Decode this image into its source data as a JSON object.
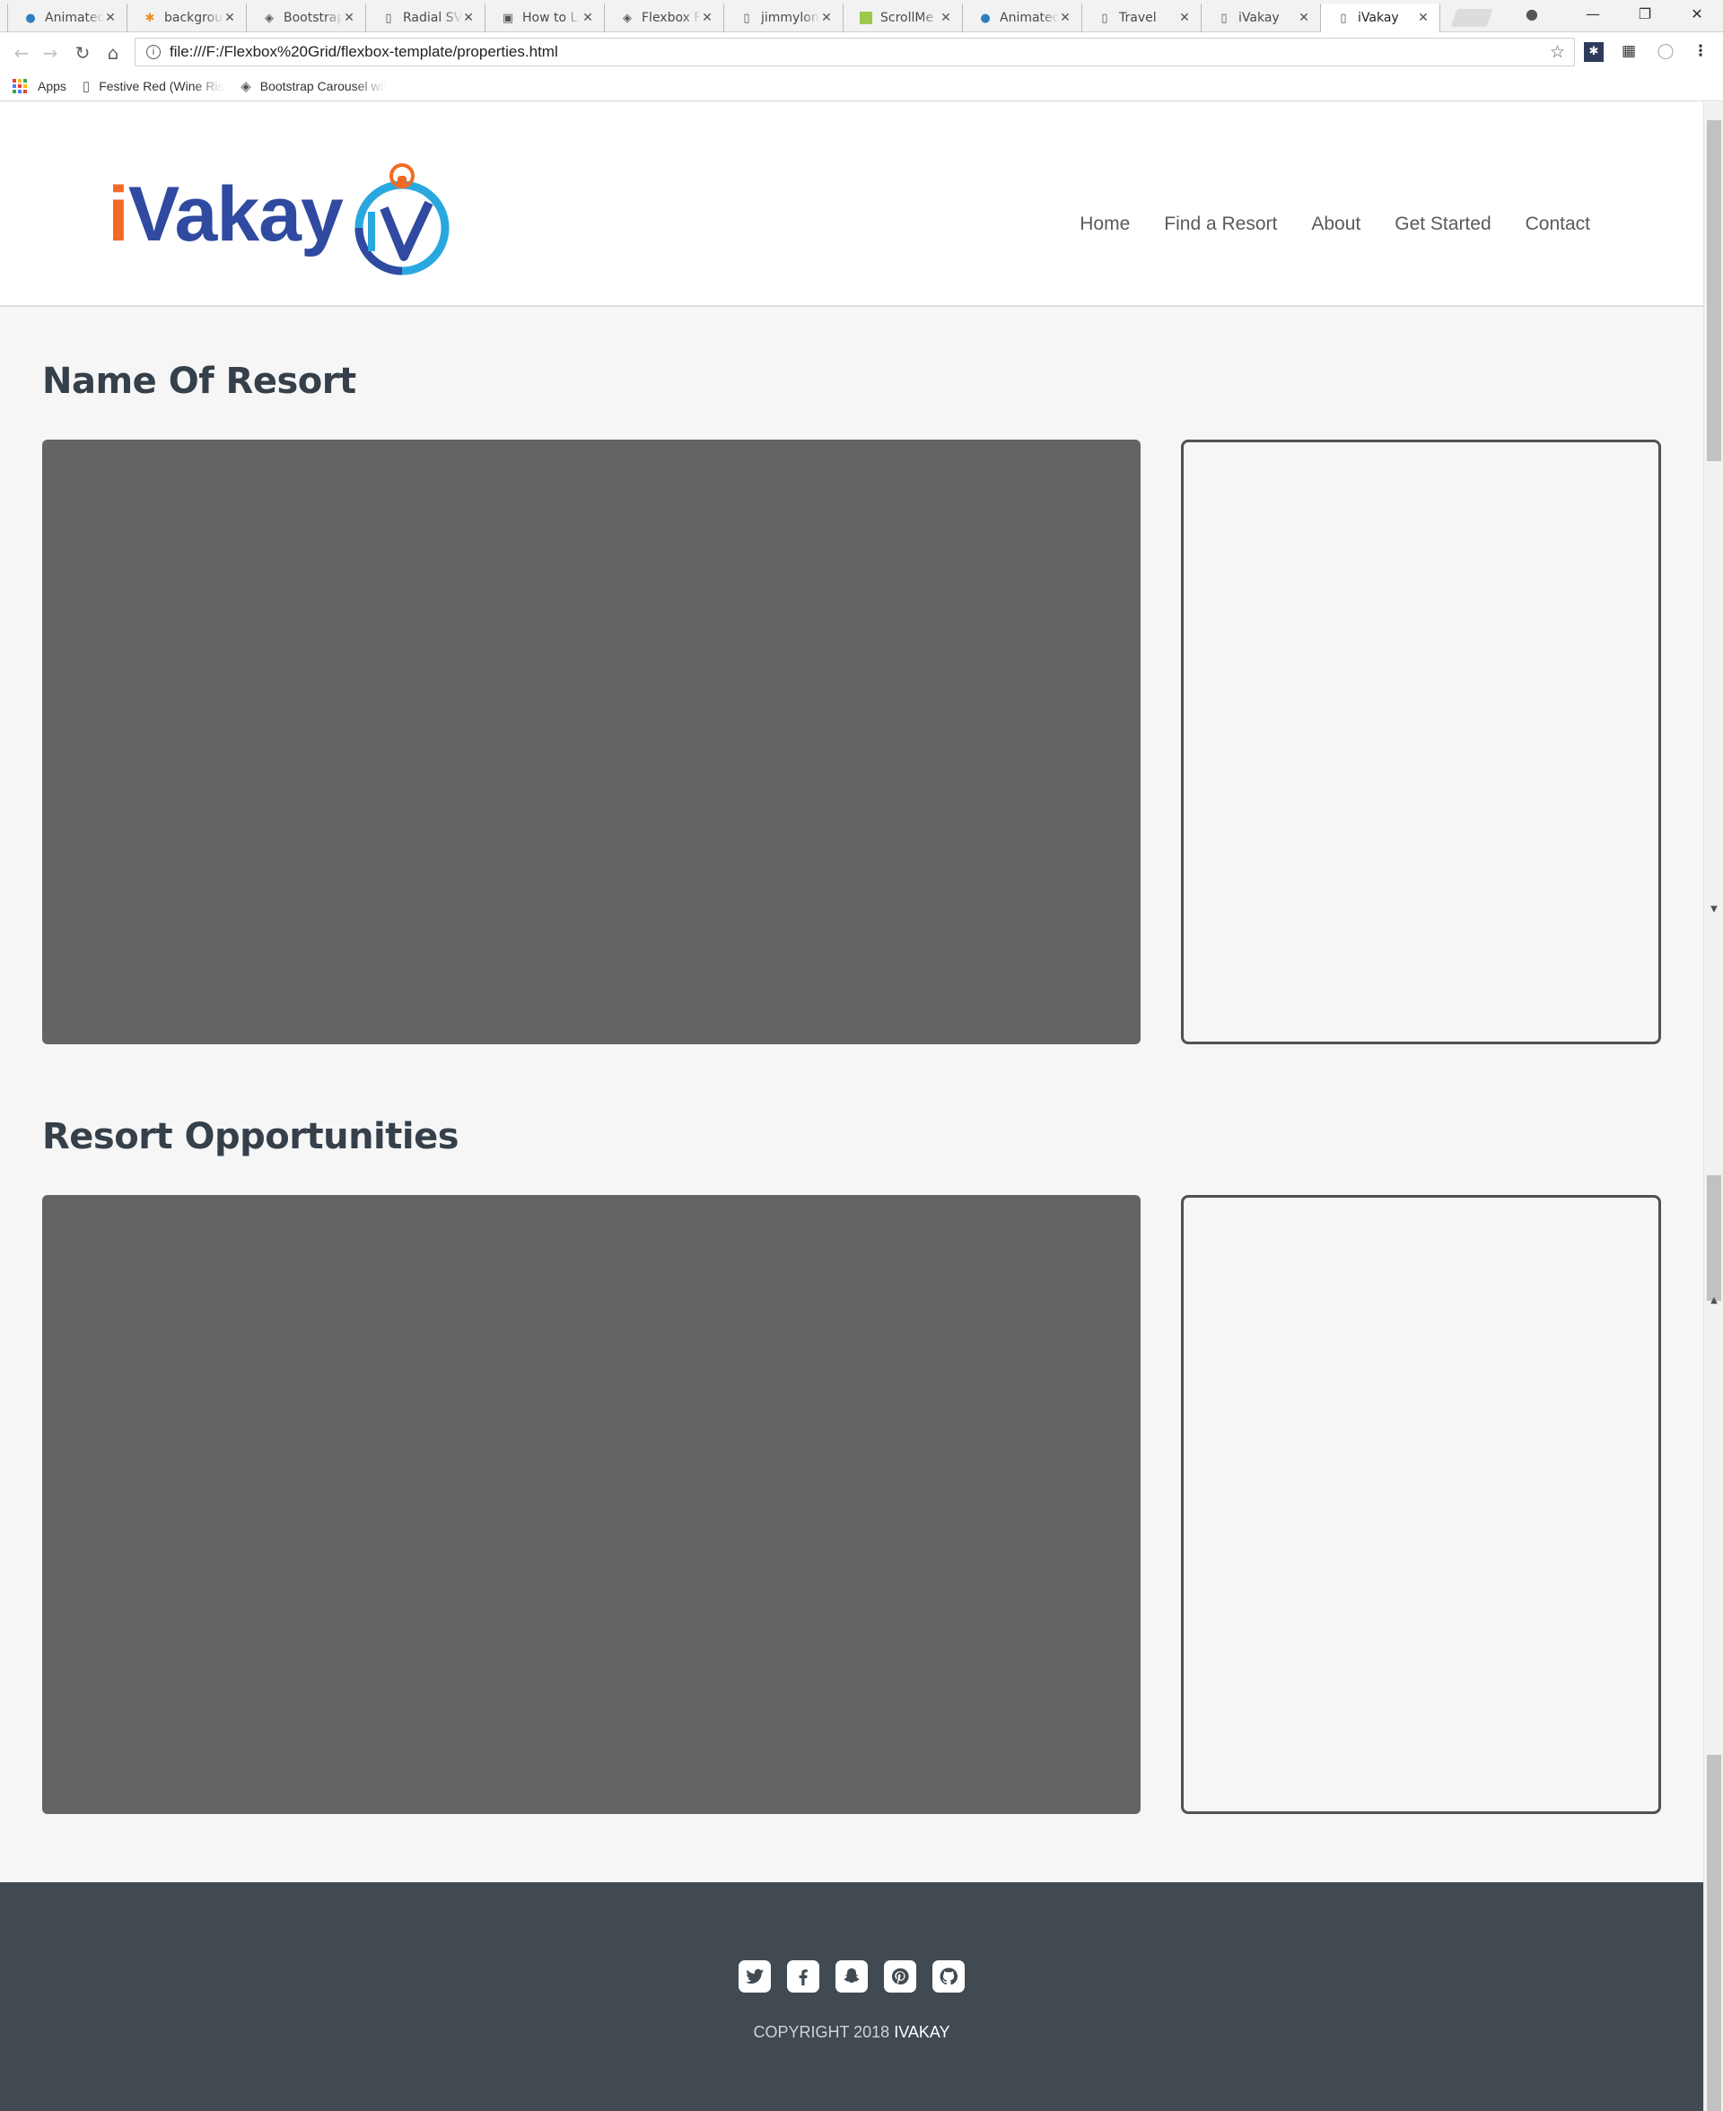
{
  "browser": {
    "tabs": [
      {
        "title": "Animated",
        "icon": "drop-icon"
      },
      {
        "title": "background",
        "icon": "asterisk-icon"
      },
      {
        "title": "Bootstrap",
        "icon": "codepen-icon"
      },
      {
        "title": "Radial SV",
        "icon": "page-icon"
      },
      {
        "title": "How to L",
        "icon": "floppy-icon"
      },
      {
        "title": "Flexbox F",
        "icon": "codepen-icon"
      },
      {
        "title": "jimmylon",
        "icon": "page-icon"
      },
      {
        "title": "ScrollMe",
        "icon": "green-square-icon"
      },
      {
        "title": "Animated",
        "icon": "drop-icon"
      },
      {
        "title": "Travel",
        "icon": "page-icon"
      },
      {
        "title": "iVakay",
        "icon": "page-icon"
      },
      {
        "title": "iVakay",
        "icon": "page-icon",
        "active": true
      }
    ],
    "url": "file:///F:/Flexbox%20Grid/flexbox-template/properties.html",
    "bookmarks": [
      {
        "label": "Apps",
        "icon": "apps-grid-icon"
      },
      {
        "label": "Festive Red (Wine Rising)",
        "icon": "page-icon"
      },
      {
        "label": "Bootstrap Carousel with",
        "icon": "codepen-icon"
      }
    ]
  },
  "site": {
    "logo_main": "iVakay",
    "nav": [
      "Home",
      "Find a Resort",
      "About",
      "Get Started",
      "Contact"
    ],
    "sections": [
      {
        "title": "Name Of Resort"
      },
      {
        "title": "Resort Opportunities"
      }
    ],
    "footer": {
      "copyright_prefix": "COPYRIGHT 2018 ",
      "copyright_brand": "IVAKAY",
      "social": [
        "twitter-icon",
        "facebook-icon",
        "snapchat-icon",
        "pinterest-icon",
        "github-icon"
      ]
    }
  },
  "colors": {
    "logo_blue": "#2f4aa0",
    "logo_orange": "#f26a24",
    "logo_light_blue": "#29a8e0",
    "page_bg": "#f6f6f6",
    "media_block": "#646464",
    "footer_bg": "#414a51"
  }
}
